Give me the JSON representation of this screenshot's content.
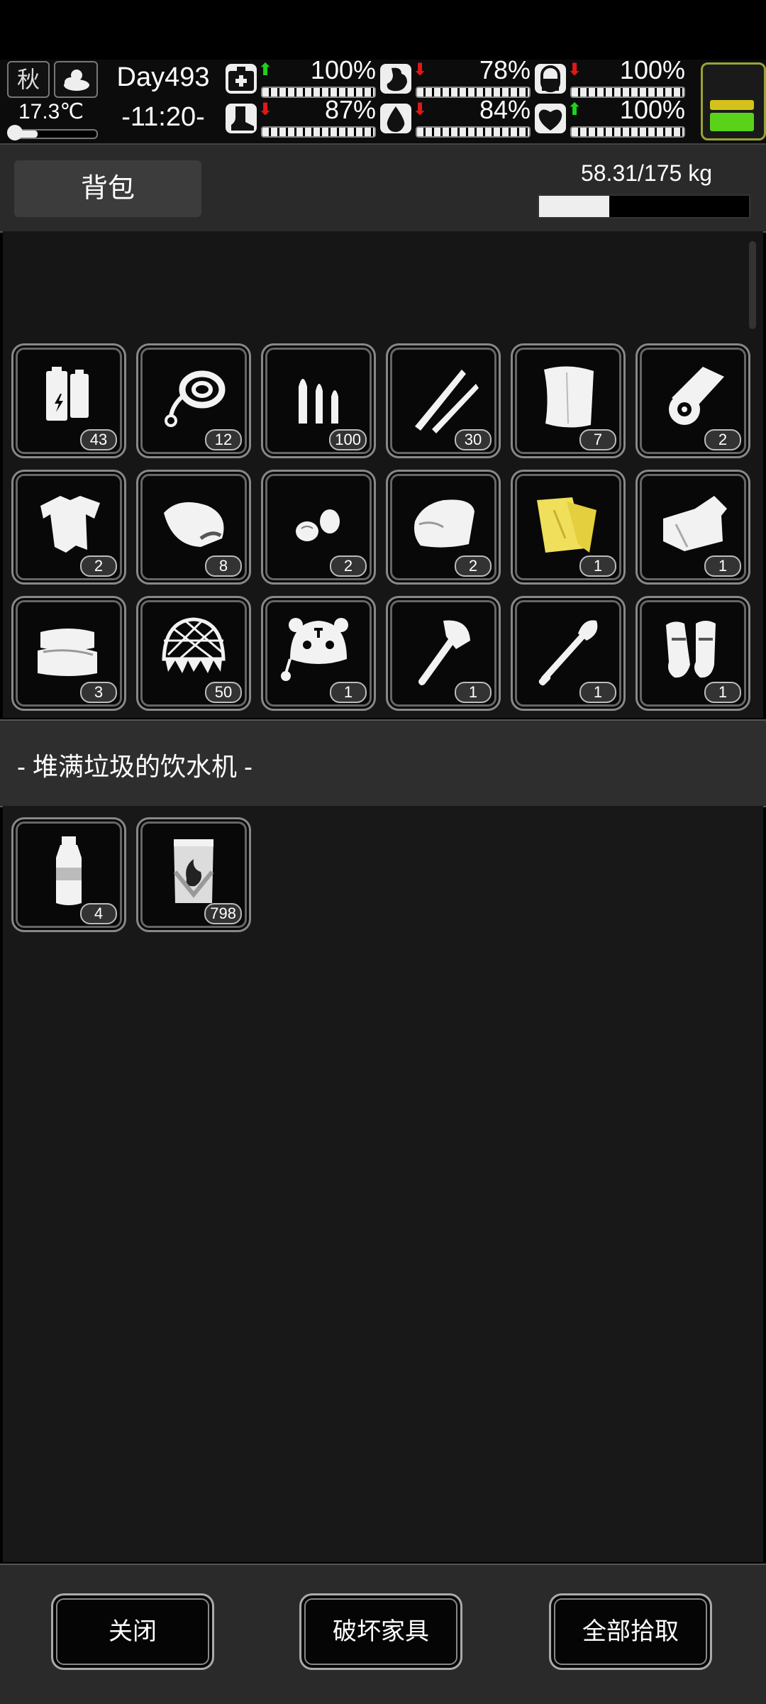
{
  "hud": {
    "season": "秋",
    "temperature": "17.3℃",
    "temperature_level": 0.3,
    "day": "Day493",
    "time": "-11:20-",
    "stats": [
      {
        "name": "health",
        "icon": "medkit-icon",
        "arrow": "up",
        "value": "100%",
        "level": 1.0
      },
      {
        "name": "hunger",
        "icon": "stomach-icon",
        "arrow": "down",
        "value": "78%",
        "level": 0.78
      },
      {
        "name": "mental",
        "icon": "capsule-icon",
        "arrow": "down",
        "value": "100%",
        "level": 1.0
      },
      {
        "name": "stamina",
        "icon": "boot-icon",
        "arrow": "down",
        "value": "87%",
        "level": 0.87
      },
      {
        "name": "thirst",
        "icon": "water-drop-icon",
        "arrow": "down",
        "value": "84%",
        "level": 0.84
      },
      {
        "name": "mood",
        "icon": "heart-icon",
        "arrow": "up",
        "value": "100%",
        "level": 1.0
      }
    ],
    "energy_colors": [
      "#d4c21a",
      "#5bd21a"
    ]
  },
  "backpack": {
    "tab_label": "背包",
    "weight": "58.31/175 kg",
    "weight_level": 0.333
  },
  "inventory": [
    {
      "icon": "battery-icon",
      "count": "43"
    },
    {
      "icon": "rope-icon",
      "count": "12"
    },
    {
      "icon": "rifle-ammo-icon",
      "count": "100"
    },
    {
      "icon": "darts-icon",
      "count": "30"
    },
    {
      "icon": "cloth-icon",
      "count": "7"
    },
    {
      "icon": "bandage-roll-icon",
      "count": "2"
    },
    {
      "icon": "torn-shirt-icon",
      "count": "2"
    },
    {
      "icon": "raw-meat-icon",
      "count": "8"
    },
    {
      "icon": "seeds-icon",
      "count": "2"
    },
    {
      "icon": "towel-icon",
      "count": "2"
    },
    {
      "icon": "yellow-cloth-icon",
      "count": "1"
    },
    {
      "icon": "folded-fabric-icon",
      "count": "1"
    },
    {
      "icon": "folded-clothes-icon",
      "count": "3"
    },
    {
      "icon": "net-icon",
      "count": "50"
    },
    {
      "icon": "tiger-hat-icon",
      "count": "1"
    },
    {
      "icon": "axe-icon",
      "count": "1"
    },
    {
      "icon": "shovel-icon",
      "count": "1"
    },
    {
      "icon": "shin-guards-icon",
      "count": "1"
    }
  ],
  "location": {
    "title": "- 堆满垃圾的饮水机 -",
    "items": [
      {
        "icon": "water-bottle-icon",
        "count": "4"
      },
      {
        "icon": "fuel-barrel-icon",
        "count": "798"
      }
    ]
  },
  "buttons": {
    "close": "关闭",
    "destroy": "破坏家具",
    "pickup_all": "全部拾取"
  }
}
